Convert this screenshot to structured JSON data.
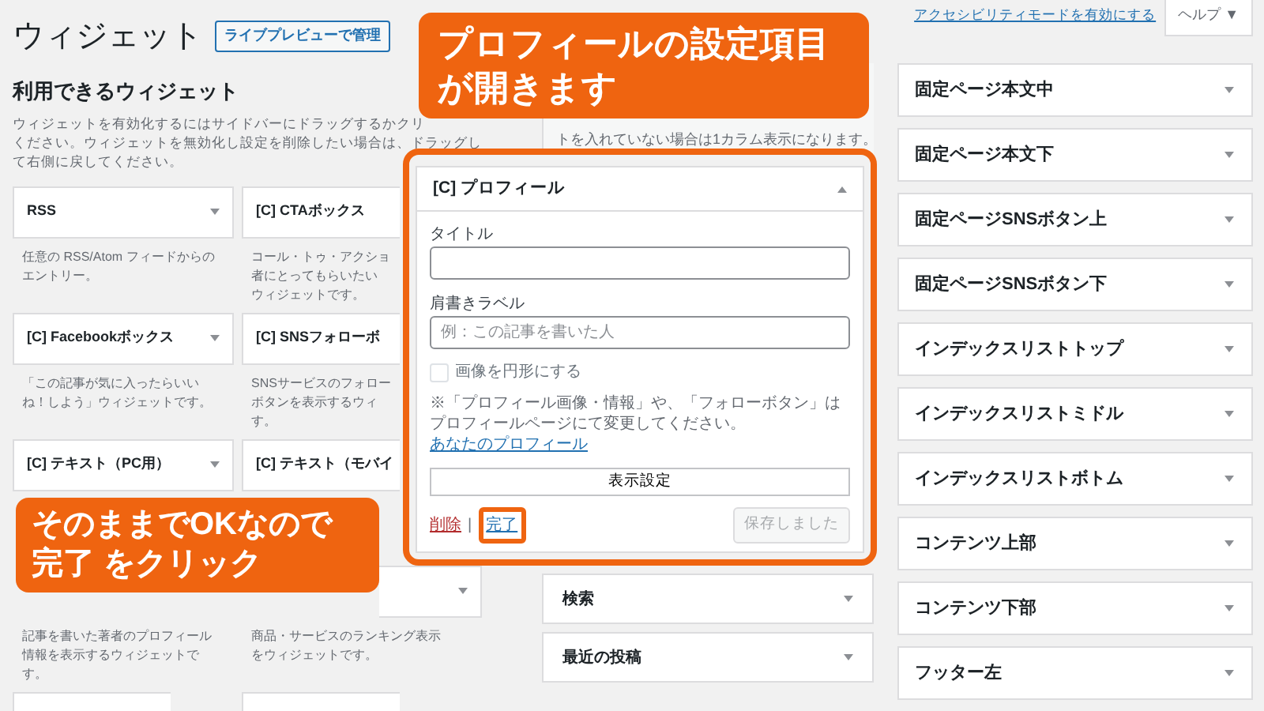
{
  "page": {
    "title": "ウィジェット",
    "manage_button": "ライブプレビューで管理"
  },
  "screen_options": {
    "accessibility_link": "アクセシビリティモードを有効にする",
    "help_button": "ヘルプ ▼"
  },
  "available_widgets": {
    "heading": "利用できるウィジェット",
    "description_lines": [
      "ウィジェットを有効化するにはサイドバーにドラッグするかクリ",
      "ください。ウィジェットを無効化し設定を削除したい場合は、ドラッグし",
      "て右側に戻してください。"
    ],
    "widgets": [
      {
        "kind": "card",
        "title": "RSS",
        "description_lines": [
          "任意の RSS/Atom フィードからの",
          "エントリー。"
        ]
      },
      {
        "kind": "card-partial",
        "title": "[C] CTAボックス",
        "description_lines": [
          "コール・トゥ・アクショ",
          "者にとってもらいたい",
          "ウィジェットです。"
        ]
      },
      {
        "kind": "card",
        "title": "[C] Facebookボックス",
        "description_lines": [
          "「この記事が気に入ったらいい",
          "ね！しよう」ウィジェットです。"
        ]
      },
      {
        "kind": "card-partial",
        "title": "[C] SNSフォローボ",
        "description_lines": [
          "SNSサービスのフォロー",
          "ボタンを表示するウィ",
          "す。"
        ]
      },
      {
        "kind": "card",
        "title": "[C] テキスト（PC用）"
      },
      {
        "kind": "card-partial",
        "title": "[C] テキスト（モバイ"
      },
      {
        "kind": "hidden",
        "description_lines": [
          "記事を書いた著者のプロフィール",
          "情報を表示するウィジェットで",
          "す。"
        ]
      },
      {
        "kind": "tail",
        "description_lines": [
          "商品・サービスのランキング表示",
          "をウィジェットです。"
        ]
      },
      {
        "kind": "card-partial"
      },
      {
        "kind": "card-partial"
      }
    ]
  },
  "sidebar": {
    "description": "トを入れていない場合は1カラム表示になります。",
    "open_widget": {
      "title": "[C] プロフィール",
      "expanded": true,
      "title_label": "タイトル",
      "caption_label": "肩書きラベル",
      "caption_placeholder": "例：この記事を書いた人",
      "round_image": {
        "label": "画像を円形にする",
        "checked": false
      },
      "note": "※「プロフィール画像・情報」や、「フォローボタン」はプロフィールページにて変更してください。",
      "profile_link": "あなたのプロフィール",
      "display_settings_button": "表示設定",
      "delete_link": "削除",
      "separator": "|",
      "done_link": "完了",
      "save_button": {
        "label": "保存しました",
        "disabled": true
      }
    },
    "widgets": [
      "検索",
      "最近の投稿"
    ]
  },
  "right_sidebar": {
    "widgets": [
      "固定ページ本文中",
      "固定ページ本文下",
      "固定ページSNSボタン上",
      "固定ページSNSボタン下",
      "インデックスリストトップ",
      "インデックスリストミドル",
      "インデックスリストボトム",
      "コンテンツ上部",
      "コンテンツ下部",
      "フッター左"
    ]
  },
  "callouts": [
    {
      "lines": [
        "プロフィールの設定項目",
        "が開きます"
      ]
    },
    {
      "lines": [
        "そのままでOKなので",
        "完了 をクリック"
      ]
    }
  ]
}
